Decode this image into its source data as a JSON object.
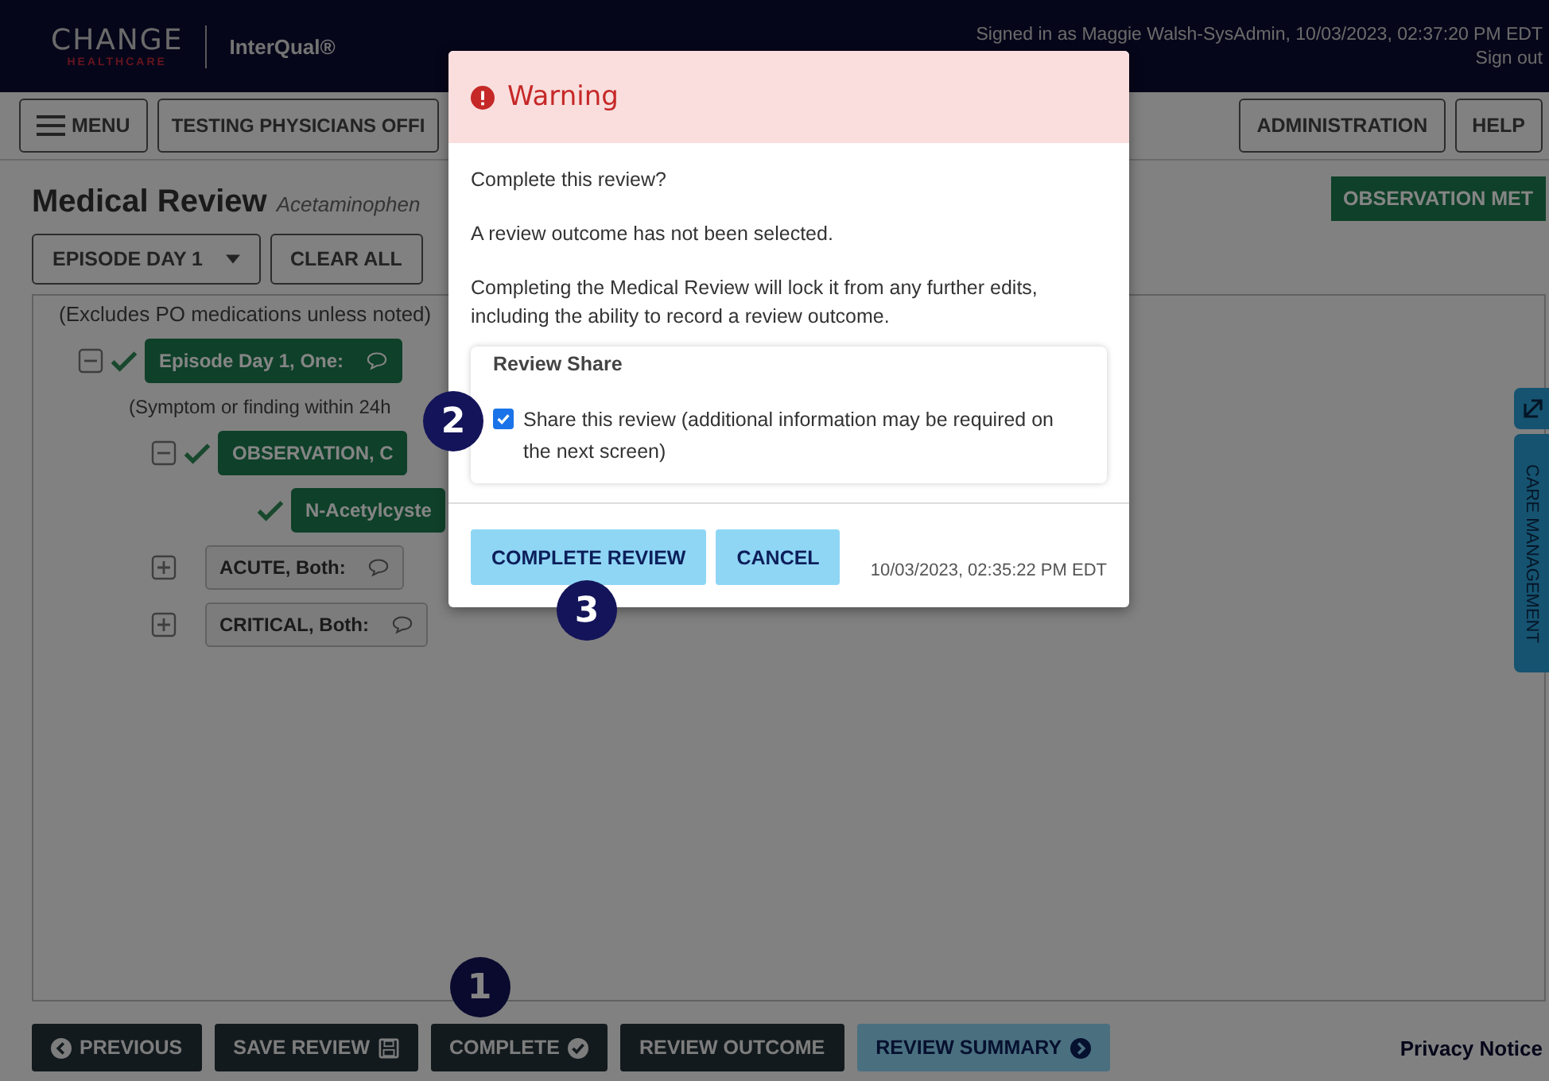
{
  "header": {
    "logo": {
      "name": "CHANGE",
      "sub": "HEALTHCARE"
    },
    "product": "InterQual®",
    "signed_in": "Signed in as Maggie Walsh-SysAdmin, 10/03/2023, 02:37:20 PM EDT",
    "sign_out": "Sign out"
  },
  "nav": {
    "menu": "MENU",
    "location": "TESTING PHYSICIANS OFFI",
    "right_buttons": [
      "ADMINISTRATION",
      "HELP"
    ]
  },
  "review": {
    "title": "Medical Review",
    "subtitle": "Acetaminophen",
    "status": "OBSERVATION MET",
    "toolbar": [
      {
        "label": "EPISODE DAY 1",
        "kind": "dropdown"
      },
      {
        "label": "CLEAR ALL",
        "kind": "button"
      }
    ]
  },
  "criteria": {
    "note": "(Excludes PO medications unless noted)",
    "tree": [
      {
        "kind": "criterion",
        "label": "Episode Day 1, One:",
        "met": true,
        "expanded": true,
        "comment": true,
        "children": [
          {
            "kind": "note",
            "label": "(Symptom or finding within 24h"
          },
          {
            "kind": "criterion",
            "label": "OBSERVATION, C",
            "met": true,
            "expanded": true,
            "children": [
              {
                "kind": "criterion",
                "label": "N-Acetylcyste",
                "met": true
              }
            ]
          },
          {
            "kind": "criterion",
            "label": "ACUTE, Both:",
            "met": false,
            "expanded": false,
            "comment": true
          },
          {
            "kind": "criterion",
            "label": "CRITICAL, Both:",
            "met": false,
            "expanded": false,
            "comment": true
          }
        ]
      }
    ]
  },
  "side_tab": {
    "label": "CARE MANAGEMENT"
  },
  "footer": {
    "buttons": [
      {
        "label": "PREVIOUS",
        "kind": "previous"
      },
      {
        "label": "SAVE REVIEW",
        "kind": "save"
      },
      {
        "label": "COMPLETE",
        "kind": "complete",
        "callout": "1"
      },
      {
        "label": "REVIEW OUTCOME",
        "kind": "outcome"
      },
      {
        "label": "REVIEW SUMMARY",
        "kind": "summary"
      }
    ],
    "privacy": "Privacy Notice"
  },
  "modal": {
    "title": "Warning",
    "paragraphs": [
      "Complete this review?",
      "A review outcome has not been selected.",
      "Completing the Medical Review will lock it from any further edits, including the ability to record a review outcome."
    ],
    "share": {
      "heading": "Review Share",
      "label": "Share this review (additional information may be required on the next screen)",
      "checked": true,
      "callout": "2"
    },
    "buttons": [
      {
        "label": "COMPLETE REVIEW",
        "callout": "3"
      },
      {
        "label": "CANCEL"
      }
    ],
    "timestamp": "10/03/2023, 02:35:22 PM EDT"
  }
}
